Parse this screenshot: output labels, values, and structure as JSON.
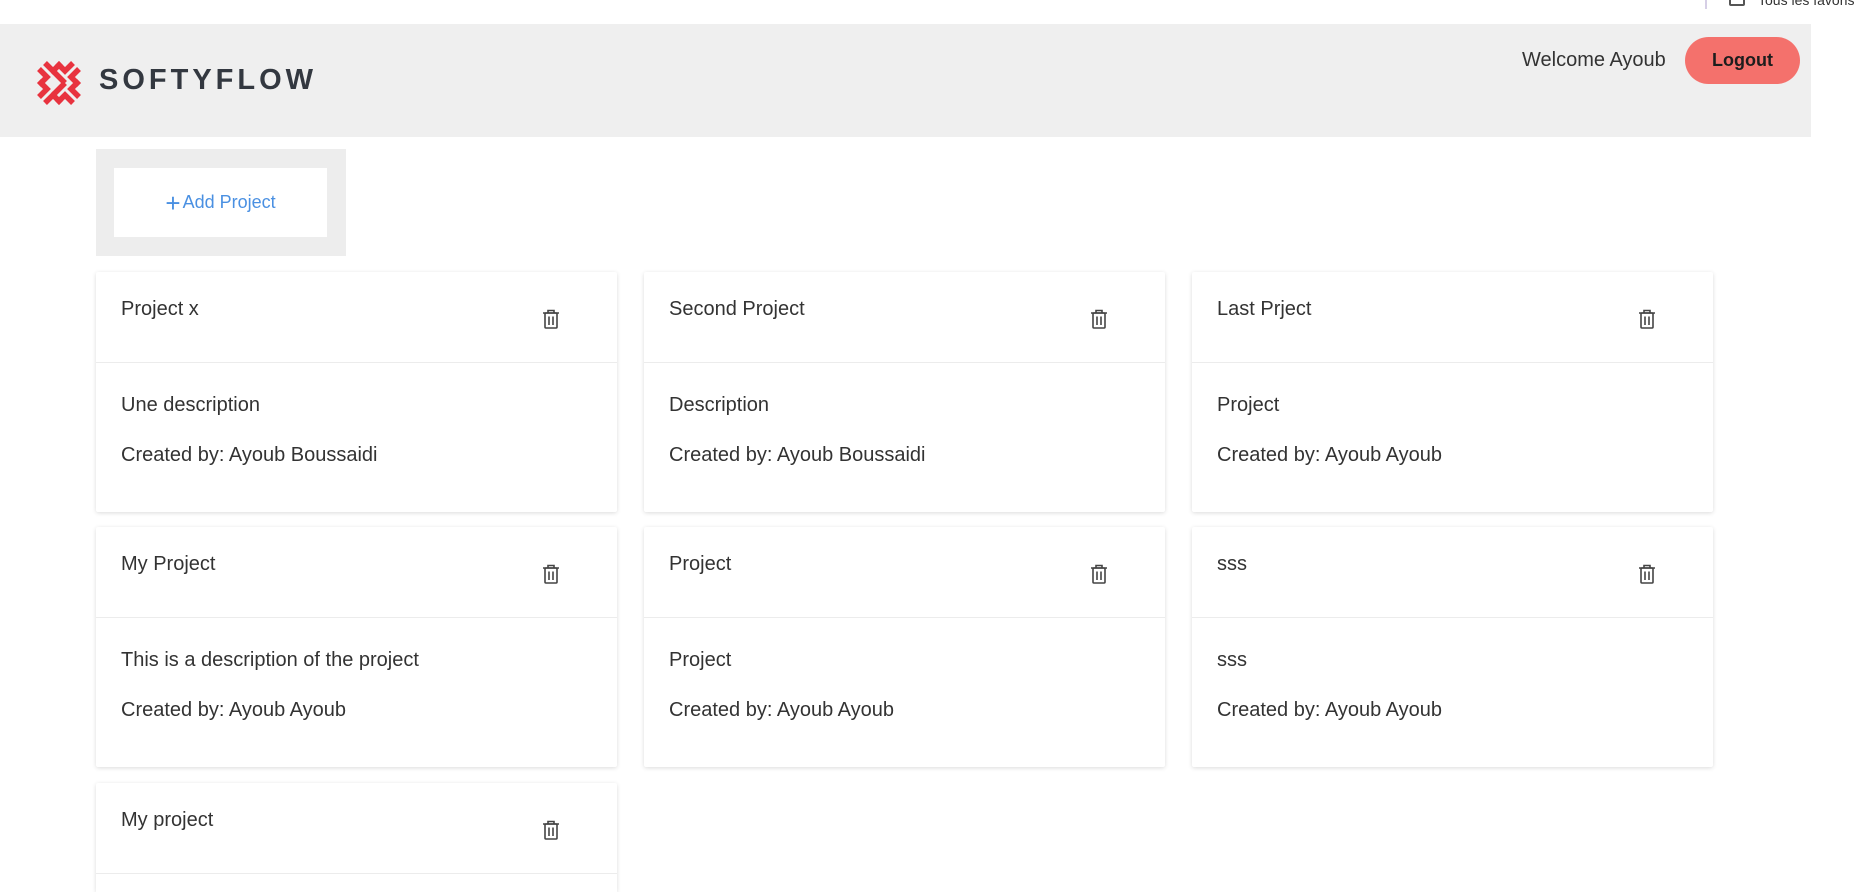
{
  "browser": {
    "favorites_label": "Tous les favoris"
  },
  "header": {
    "logo_text": "SOFTYFLOW",
    "welcome": "Welcome Ayoub",
    "logout_label": "Logout",
    "accent_color": "#f4716c",
    "logo_color": "#e8333f"
  },
  "toolbar": {
    "add_label": "Add Project",
    "add_icon": "plus-icon",
    "link_color": "#4a90e2"
  },
  "projects": [
    {
      "title": "Project x",
      "description": "Une description",
      "created_by": "Created by: Ayoub Boussaidi",
      "delete_icon": "trash-icon"
    },
    {
      "title": "Second Project",
      "description": "Description",
      "created_by": "Created by: Ayoub Boussaidi",
      "delete_icon": "trash-icon"
    },
    {
      "title": "Last Prject",
      "description": "Project",
      "created_by": "Created by: Ayoub Ayoub",
      "delete_icon": "trash-icon"
    },
    {
      "title": "My Project",
      "description": "This is a description of the project",
      "created_by": "Created by: Ayoub Ayoub",
      "delete_icon": "trash-icon"
    },
    {
      "title": "Project",
      "description": "Project",
      "created_by": "Created by: Ayoub Ayoub",
      "delete_icon": "trash-icon"
    },
    {
      "title": "sss",
      "description": "sss",
      "created_by": "Created by: Ayoub Ayoub",
      "delete_icon": "trash-icon"
    },
    {
      "title": "My project",
      "delete_icon": "trash-icon"
    }
  ]
}
